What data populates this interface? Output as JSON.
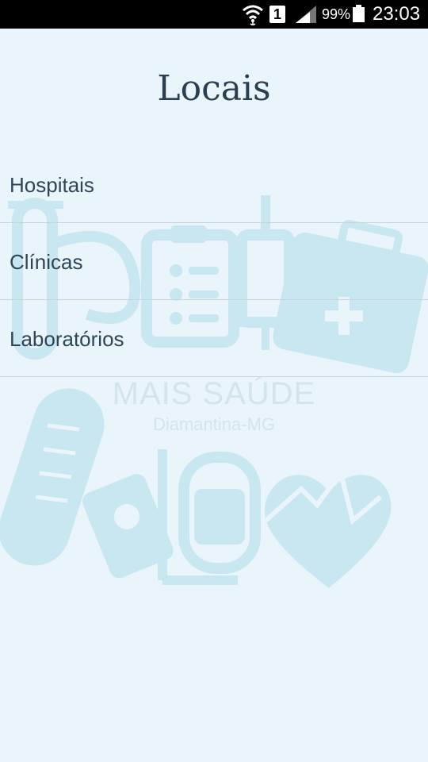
{
  "status_bar": {
    "sim_slot": "1",
    "battery_percent": "99%",
    "time": "23:03",
    "icons": [
      "wifi-icon",
      "sim-icon",
      "signal-icon",
      "battery-icon"
    ]
  },
  "page": {
    "title": "Locais"
  },
  "list": {
    "items": [
      {
        "label": "Hospitais"
      },
      {
        "label": "Clínicas"
      },
      {
        "label": "Laboratórios"
      }
    ]
  },
  "background": {
    "brand": "MAIS SAÚDE",
    "subtitle": "Diamantina-MG",
    "art_color": "#c8e7f0"
  }
}
